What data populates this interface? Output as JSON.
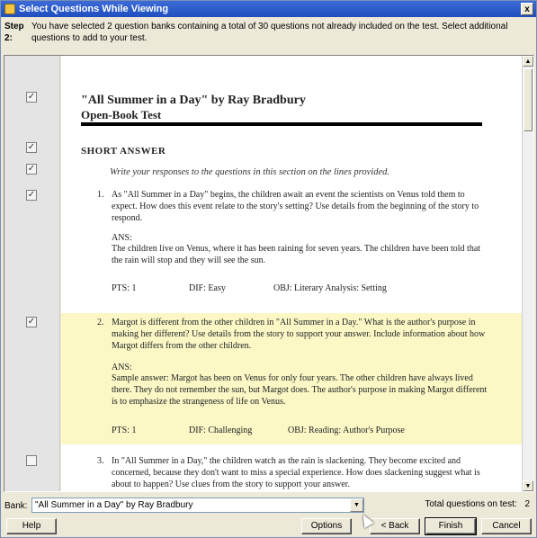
{
  "window": {
    "title": "Select Questions While Viewing",
    "close_label": "x"
  },
  "step": {
    "label": "Step 2:",
    "text": "You have selected 2 question banks containing a total of 30 questions not already included on the test. Select additional questions to add to your test."
  },
  "document": {
    "title": "\"All Summer in a Day\" by Ray Bradbury",
    "subtitle": "Open-Book Test",
    "section": "SHORT ANSWER",
    "instructions": "Write your responses to the questions in this section on the lines provided.",
    "questions": [
      {
        "number": "1.",
        "text": "As \"All Summer in a Day\" begins, the children await an event the scientists on Venus told them to expect. How does this event relate to the story's setting? Use details from the beginning of the story to respond.",
        "ans_label": "ANS:",
        "answer": "The children live on Venus, where it has been raining for seven years. The children have been told that the rain will stop and they will see the sun.",
        "pts": "PTS:  1",
        "dif": "DIF:   Easy",
        "obj": "OBJ:   Literary Analysis: Setting",
        "highlighted": false
      },
      {
        "number": "2.",
        "text": "Margot is different from the other children in \"All Summer in a Day.\" What is the author's purpose in making her different? Use details from the story to support your answer. Include information about how Margot differs from the other children.",
        "ans_label": "ANS:",
        "answer": "Sample answer: Margot has been on Venus for only four years. The other children have always lived there. They do not remember the sun, but Margot does. The author's purpose in making Margot different is to emphasize the strangeness of life on Venus.",
        "pts": "PTS:  1",
        "dif": "DIF:   Challenging",
        "obj": "OBJ:   Reading: Author's Purpose",
        "highlighted": true
      },
      {
        "number": "3.",
        "text": "In \"All Summer in a Day,\" the children watch as the rain is slackening. They become excited and concerned, because they don't want to miss a special experience. How does slackening suggest what is about to happen? Use clues from the story to support your answer.",
        "highlighted": false
      }
    ]
  },
  "checkboxes": [
    {
      "checked": true
    },
    {
      "checked": true
    },
    {
      "checked": true
    },
    {
      "checked": true
    },
    {
      "checked": true
    },
    {
      "checked": false
    }
  ],
  "bank": {
    "label": "Bank:",
    "value": "\"All Summer in a Day\" by Ray Bradbury",
    "total_label": "Total questions on test:",
    "total_value": "2"
  },
  "buttons": {
    "help": "Help",
    "options": "Options",
    "back": "< Back",
    "finish": "Finish",
    "cancel": "Cancel"
  }
}
